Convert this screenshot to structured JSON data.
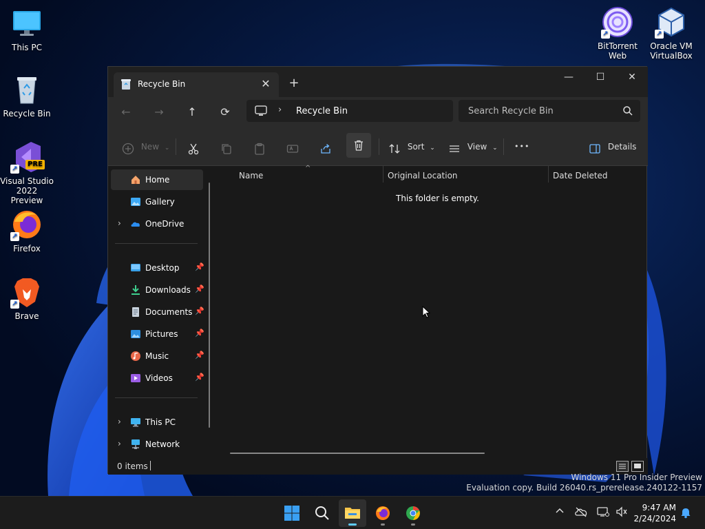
{
  "desktop": {
    "icons": [
      {
        "label": "This PC"
      },
      {
        "label": "Recycle Bin"
      },
      {
        "label": "Visual Studio 2022 Preview",
        "badge": "PRE"
      },
      {
        "label": "Firefox"
      },
      {
        "label": "Brave"
      },
      {
        "label": "BitTorrent Web"
      },
      {
        "label": "Oracle VM VirtualBox"
      }
    ],
    "watermark_line1": "Windows 11 Pro Insider Preview",
    "watermark_line2": "Evaluation copy. Build 26040.rs_prerelease.240122-1157"
  },
  "explorer": {
    "tab_title": "Recycle Bin",
    "new_tab": "+",
    "breadcrumb": "Recycle Bin",
    "search_placeholder": "Search Recycle Bin",
    "toolbar": {
      "new_label": "New",
      "sort_label": "Sort",
      "view_label": "View",
      "more_label": "•••",
      "details_label": "Details"
    },
    "nav": {
      "home": "Home",
      "gallery": "Gallery",
      "onedrive": "OneDrive",
      "desktop": "Desktop",
      "downloads": "Downloads",
      "documents": "Documents",
      "pictures": "Pictures",
      "music": "Music",
      "videos": "Videos",
      "thispc": "This PC",
      "network": "Network"
    },
    "columns": {
      "name": "Name",
      "original_location": "Original Location",
      "date_deleted": "Date Deleted"
    },
    "empty_message": "This folder is empty.",
    "status": "0 items"
  },
  "taskbar": {
    "time": "9:47 AM",
    "date": "2/24/2024"
  },
  "colors": {
    "accent": "#60cdff",
    "window_bg": "#191919",
    "toolbar_bg": "#2b2b2b"
  }
}
